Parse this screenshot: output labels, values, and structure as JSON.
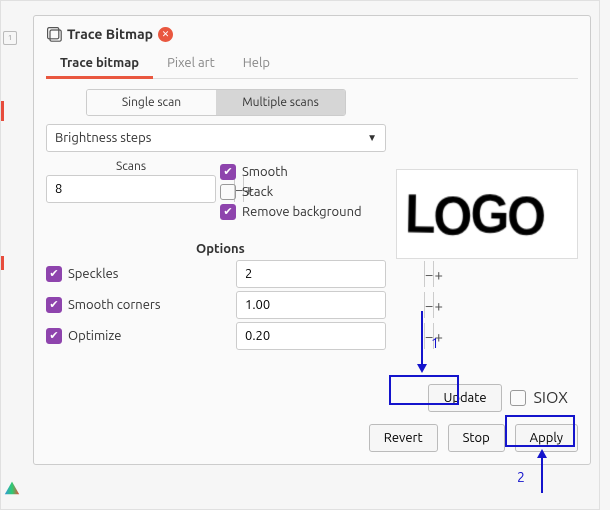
{
  "dialog": {
    "title": "Trace Bitmap",
    "tabs": [
      {
        "label": "Trace bitmap",
        "active": true
      },
      {
        "label": "Pixel art",
        "active": false
      },
      {
        "label": "Help",
        "active": false
      }
    ],
    "scan_mode": {
      "single": "Single scan",
      "multiple": "Multiple scans",
      "active": "multiple"
    },
    "method": "Brightness steps",
    "scans": {
      "label": "Scans",
      "value": "8"
    },
    "checks": {
      "smooth": {
        "label": "Smooth",
        "checked": true
      },
      "stack": {
        "label": "Stack",
        "checked": false
      },
      "remove_bg": {
        "label": "Remove background",
        "checked": true
      }
    },
    "options": {
      "heading": "Options",
      "speckles": {
        "label": "Speckles",
        "checked": true,
        "value": "2"
      },
      "smooth_corners": {
        "label": "Smooth corners",
        "checked": true,
        "value": "1.00"
      },
      "optimize": {
        "label": "Optimize",
        "checked": true,
        "value": "0.20"
      }
    },
    "update": {
      "label": "Update"
    },
    "siox": {
      "label": "SIOX",
      "checked": false
    },
    "buttons": {
      "revert": "Revert",
      "stop": "Stop",
      "apply": "Apply"
    },
    "preview_text": "LOGO"
  },
  "annotations": {
    "n1": "1",
    "n2": "2"
  }
}
